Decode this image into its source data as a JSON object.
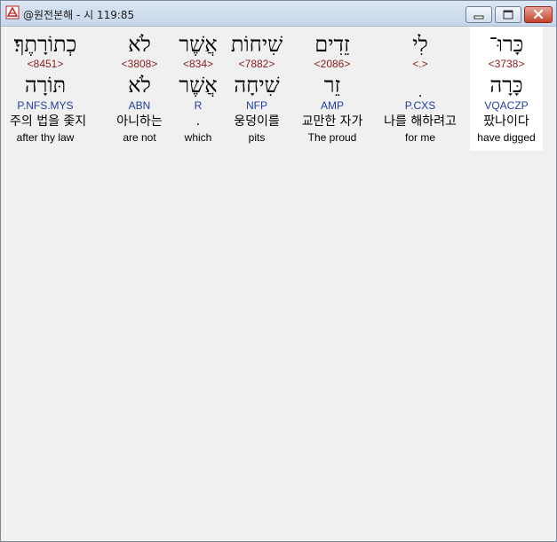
{
  "window": {
    "title": "@원전본해 - 시 119:85"
  },
  "words": [
    {
      "hebrew": "כְתוֹרָתֶךָ׃",
      "strong": "<8451>",
      "lemma": "תּוֹרָה",
      "morph": "P.NFS.MYS",
      "korean": "주의 법을 좇지",
      "english": "after thy law"
    },
    {
      "hebrew": "לֹא",
      "strong": "<3808>",
      "lemma": "לֹא",
      "morph": "ABN",
      "korean": "아니하는",
      "english": "are not"
    },
    {
      "hebrew": "אֲשֶׁר",
      "strong": "<834>",
      "lemma": "אֲשֶׁר",
      "morph": "R",
      "korean": ".",
      "english": "which"
    },
    {
      "hebrew": "שִׁיחוֹת",
      "strong": "<7882>",
      "lemma": "שִׁיחָה",
      "morph": "NFP",
      "korean": "웅덩이를",
      "english": "pits"
    },
    {
      "hebrew": "זֵדִים",
      "strong": "<2086>",
      "lemma": "זֵר",
      "morph": "AMP",
      "korean": "교만한 자가",
      "english": "The proud"
    },
    {
      "hebrew": "לִי",
      "strong": "<.>",
      "lemma": "ׅ",
      "morph": "P.CXS",
      "korean": "나를 해하려고",
      "english": "for me"
    },
    {
      "hebrew": "כָּרוּ־",
      "strong": "<3738>",
      "lemma": "כָּרָה",
      "morph": "VQACZP",
      "korean": "팠나이다",
      "english": "have digged"
    }
  ]
}
